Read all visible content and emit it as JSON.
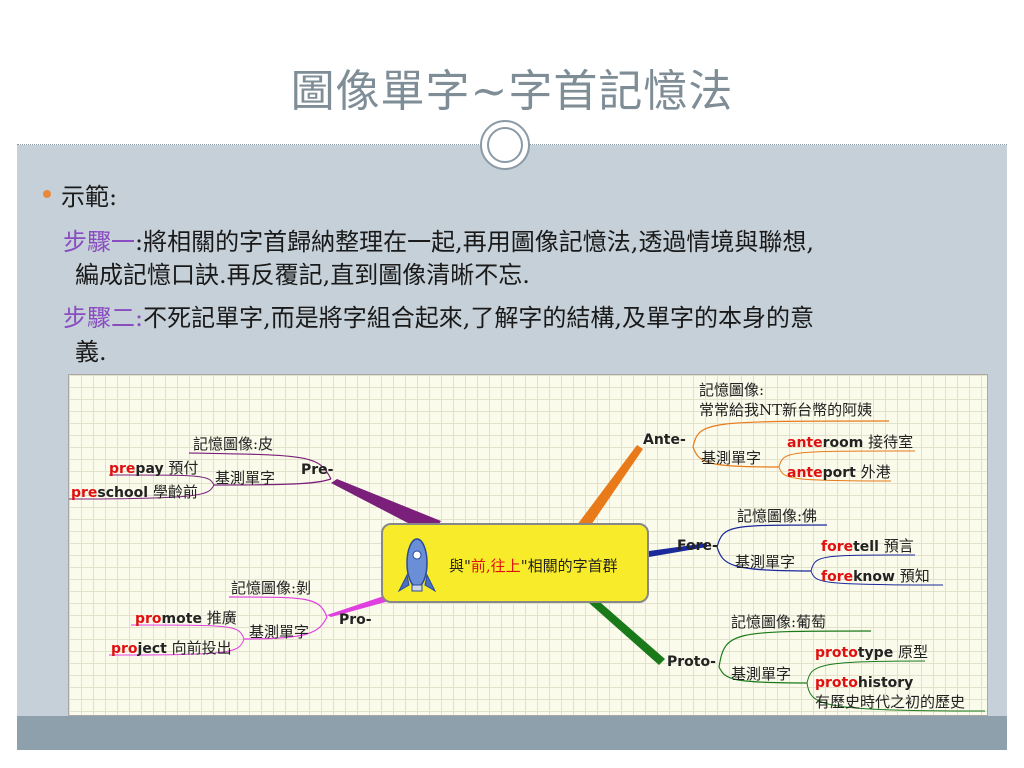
{
  "slide": {
    "title": "圖像單字~字首記憶法",
    "bullet": "示範:",
    "step1_label": "步驟一",
    "step1_text": ":將相關的字首歸納整理在一起,再用圖像記憶法,透過情境與聯想,",
    "step1_text2": "編成記憶口訣.再反覆記,直到圖像清晰不忘.",
    "step2_label": "步驟二:",
    "step2_text": "不死記單字,而是將字組合起來,了解字的結構,及單字的本身的意",
    "step2_text2": "義."
  },
  "mindmap": {
    "central": {
      "pre": "與\"",
      "highlight": "前,往上",
      "post": "\"相關的字首群"
    },
    "pre": {
      "label": "Pre-",
      "image": "記憶圖像:皮",
      "words_label": "基測單字",
      "words": [
        {
          "prefix": "pre",
          "rest": "pay",
          "meaning": "預付"
        },
        {
          "prefix": "pre",
          "rest": "school",
          "meaning": "學齡前"
        }
      ]
    },
    "pro": {
      "label": "Pro-",
      "image": "記憶圖像:剝",
      "words_label": "基測單字",
      "words": [
        {
          "prefix": "pro",
          "rest": "mote",
          "meaning": "推廣"
        },
        {
          "prefix": "pro",
          "rest": "ject",
          "meaning": "向前投出"
        }
      ]
    },
    "ante": {
      "label": "Ante-",
      "image_title": "記憶圖像:",
      "image": "常常給我NT新台幣的阿姨",
      "words_label": "基測單字",
      "words": [
        {
          "prefix": "ante",
          "rest": "room",
          "meaning": "接待室"
        },
        {
          "prefix": "ante",
          "rest": "port",
          "meaning": "外港"
        }
      ]
    },
    "fore": {
      "label": "Fore-",
      "image": "記憶圖像:佛",
      "words_label": "基測單字",
      "words": [
        {
          "prefix": "fore",
          "rest": "tell",
          "meaning": "預言"
        },
        {
          "prefix": "fore",
          "rest": "know",
          "meaning": "預知"
        }
      ]
    },
    "proto": {
      "label": "Proto-",
      "image": "記憶圖像:葡萄",
      "words_label": "基測單字",
      "words": [
        {
          "prefix": "proto",
          "rest": "type",
          "meaning": "原型"
        },
        {
          "prefix": "proto",
          "rest": "history",
          "meaning": "有歷史時代之初的歷史"
        }
      ]
    },
    "colors": {
      "pre": "#7a1f7a",
      "pro": "#e040e0",
      "ante": "#e87a1a",
      "fore": "#1a2a9a",
      "proto": "#1a7a1a",
      "highlight": "#e01010"
    }
  }
}
